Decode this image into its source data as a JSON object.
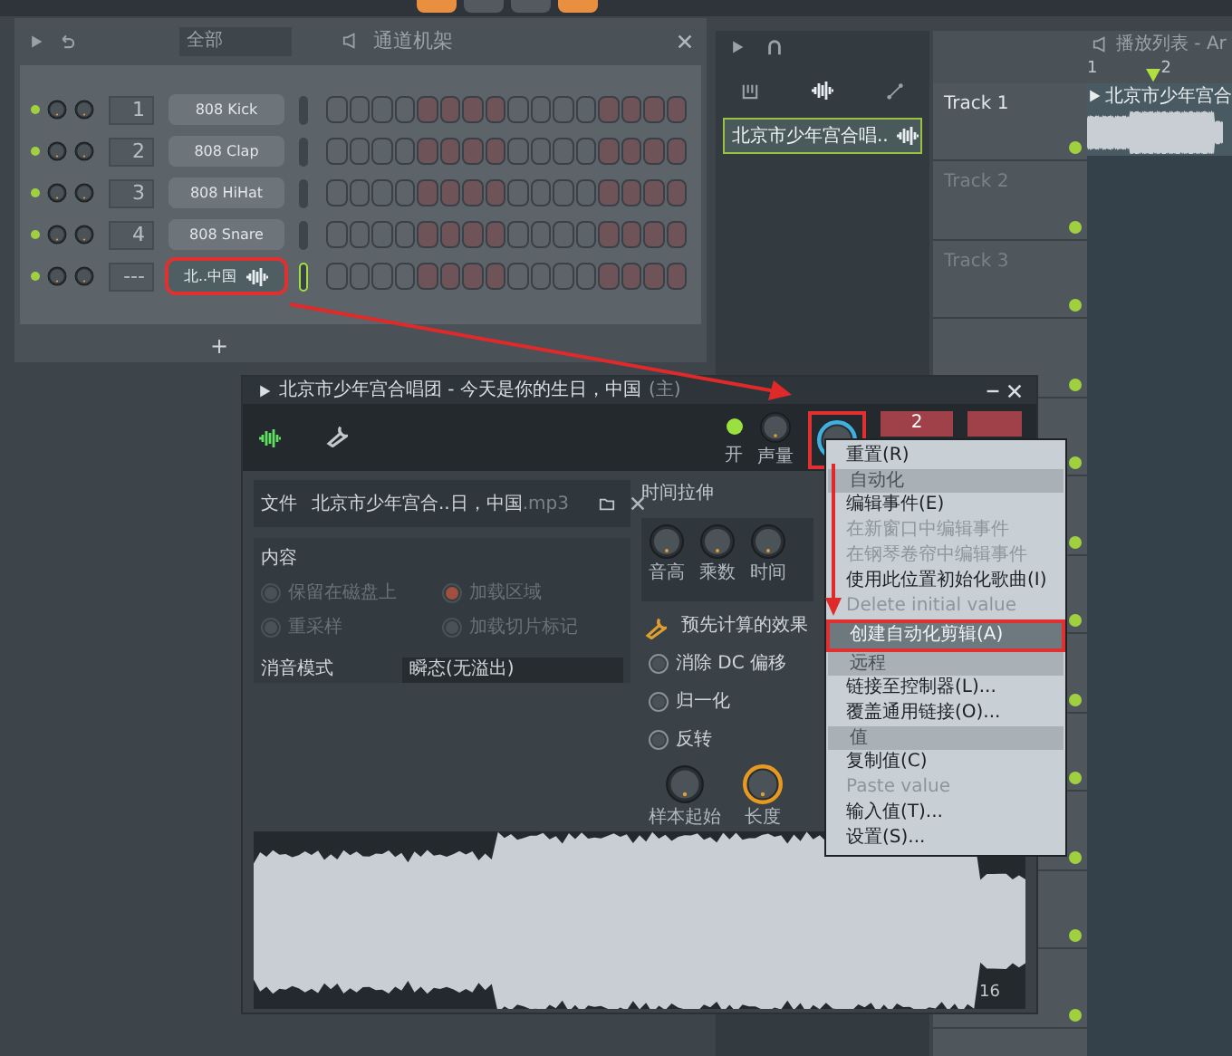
{
  "channel_rack": {
    "filter": "全部",
    "title": "通道机架",
    "add_label": "+",
    "channels": [
      {
        "number": "1",
        "name": "808 Kick",
        "kind": "synth",
        "selected": false
      },
      {
        "number": "2",
        "name": "808 Clap",
        "kind": "synth",
        "selected": false
      },
      {
        "number": "3",
        "name": "808 HiHat",
        "kind": "synth",
        "selected": false
      },
      {
        "number": "4",
        "name": "808 Snare",
        "kind": "synth",
        "selected": false
      },
      {
        "number": "---",
        "name": "北..中国",
        "kind": "audio",
        "selected": true
      }
    ]
  },
  "picker": {
    "item": "北京市少年宫合唱.."
  },
  "playlist": {
    "title": "播放列表 - Ar",
    "bars": [
      "1",
      "2"
    ],
    "clip": "北京市少年宫合",
    "tracks": [
      {
        "name": "Track 1",
        "active": true
      },
      {
        "name": "Track 2",
        "active": false
      },
      {
        "name": "Track 3",
        "active": false
      }
    ]
  },
  "sampler": {
    "title": "北京市少年宫合唱团 - 今天是你的生日，中国",
    "title_suffix": "(主)",
    "toolbar": [
      {
        "label": "开",
        "kind": "led"
      },
      {
        "label": "声量",
        "kind": "knob"
      }
    ],
    "toolbar_button": "2",
    "file_label": "文件",
    "file_name": "北京市少年宫合..日，中国",
    "file_ext": ".mp3",
    "content_title": "内容",
    "options": [
      {
        "label": "保留在磁盘上",
        "checked": false
      },
      {
        "label": "加载区域",
        "checked": true
      },
      {
        "label": "重采样",
        "checked": false
      },
      {
        "label": "加载切片标记",
        "checked": false
      }
    ],
    "declick_label": "消音模式",
    "declick_value": "瞬态(无溢出)",
    "stretch_title": "时间拉伸",
    "stretch_knobs": [
      "音高",
      "乘数",
      "时间"
    ],
    "effects_title": "预先计算的效果",
    "effects": [
      {
        "label": "消除 DC 偏移",
        "checked": false
      },
      {
        "label": "归一化",
        "checked": false
      },
      {
        "label": "反转",
        "checked": false
      }
    ],
    "knobs": [
      {
        "label": "样本起始",
        "selected": false
      },
      {
        "label": "长度",
        "selected": true
      }
    ],
    "footer": "16"
  },
  "context_menu": [
    {
      "kind": "item",
      "label": "重置(R)",
      "disabled": false,
      "selected": false
    },
    {
      "kind": "header",
      "label": "自动化"
    },
    {
      "kind": "item",
      "label": "编辑事件(E)",
      "disabled": false,
      "selected": false
    },
    {
      "kind": "item",
      "label": "在新窗口中编辑事件",
      "disabled": true,
      "selected": false
    },
    {
      "kind": "item",
      "label": "在钢琴卷帘中编辑事件",
      "disabled": true,
      "selected": false
    },
    {
      "kind": "item",
      "label": "使用此位置初始化歌曲(I)",
      "disabled": false,
      "selected": false
    },
    {
      "kind": "item",
      "label": "Delete initial value",
      "disabled": true,
      "selected": false
    },
    {
      "kind": "item",
      "label": "创建自动化剪辑(A)",
      "disabled": false,
      "selected": true
    },
    {
      "kind": "header",
      "label": "远程"
    },
    {
      "kind": "item",
      "label": "链接至控制器(L)...",
      "disabled": false,
      "selected": false
    },
    {
      "kind": "item",
      "label": "覆盖通用链接(O)...",
      "disabled": false,
      "selected": false
    },
    {
      "kind": "header",
      "label": "值"
    },
    {
      "kind": "item",
      "label": "复制值(C)",
      "disabled": false,
      "selected": false
    },
    {
      "kind": "item",
      "label": "Paste value",
      "disabled": true,
      "selected": false
    },
    {
      "kind": "item",
      "label": "输入值(T)...",
      "disabled": false,
      "selected": false
    },
    {
      "kind": "item",
      "label": "设置(S)...",
      "disabled": false,
      "selected": false
    }
  ]
}
